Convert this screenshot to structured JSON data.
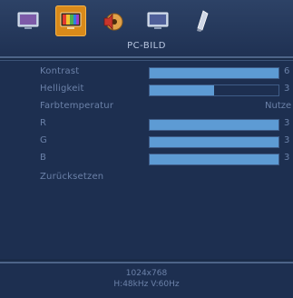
{
  "header": {
    "title": "PC-BILD",
    "tabs": [
      {
        "icon": "monitor-settings-icon",
        "active": false
      },
      {
        "icon": "pc-picture-icon",
        "active": true
      },
      {
        "icon": "audio-icon",
        "active": false
      },
      {
        "icon": "display-icon",
        "active": false
      },
      {
        "icon": "feature-icon",
        "active": false
      }
    ]
  },
  "menu": {
    "items": [
      {
        "label": "Kontrast",
        "value": "6",
        "level": 1.0
      },
      {
        "label": "Helligkeit",
        "value": "3",
        "level": 0.5
      },
      {
        "label": "Farbtemperatur",
        "value": "Nutze"
      },
      {
        "label": "R",
        "value": "3",
        "level": 1.0
      },
      {
        "label": "G",
        "value": "3",
        "level": 1.0
      },
      {
        "label": "B",
        "value": "3",
        "level": 1.0
      },
      {
        "label": "Zurücksetzen"
      }
    ]
  },
  "info": {
    "resolution": "1024x768",
    "frequency": "H:48kHz   V:60Hz"
  },
  "colors": {
    "background": "#1a2b48",
    "active_tab": "#d98a1a",
    "bar_fill": "#5d9bd4",
    "label": "#6b81a8"
  }
}
